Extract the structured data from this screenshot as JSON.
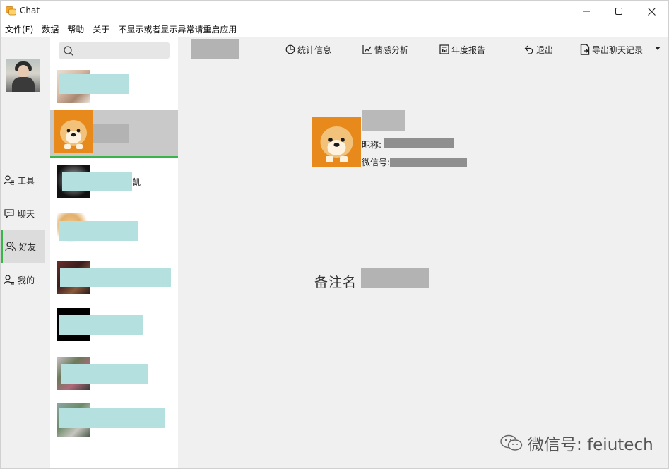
{
  "window": {
    "title": "Chat",
    "controls": {
      "minimize": "—",
      "maximize": "☐",
      "close": "✕"
    }
  },
  "menu": {
    "items": [
      "文件(F)",
      "数据",
      "帮助",
      "关于",
      "不显示或者显示异常请重启应用"
    ]
  },
  "nav": {
    "items": [
      {
        "label": "工具",
        "icon": "tools-user-icon"
      },
      {
        "label": "聊天",
        "icon": "chat-bubble-icon"
      },
      {
        "label": "好友",
        "icon": "friends-icon",
        "active": true
      },
      {
        "label": "我的",
        "icon": "profile-icon"
      }
    ]
  },
  "contacts": {
    "visible_name_fragments": [
      "凯"
    ]
  },
  "toolbar": {
    "stats_label": "统计信息",
    "emotion_label": "情感分析",
    "annual_label": "年度报告",
    "exit_label": "退出",
    "export_label": "导出聊天记录"
  },
  "detail": {
    "nickname_label": "昵称:",
    "wechat_id_label": "微信号:",
    "remark_label": "备注名"
  },
  "watermark": {
    "text": "微信号: feiutech"
  },
  "colors": {
    "accent_green": "#3bb54a",
    "mask_cyan": "#b5e0e0",
    "mask_gray": "#b3b3b3",
    "panel_bg": "#f0f0f0"
  }
}
